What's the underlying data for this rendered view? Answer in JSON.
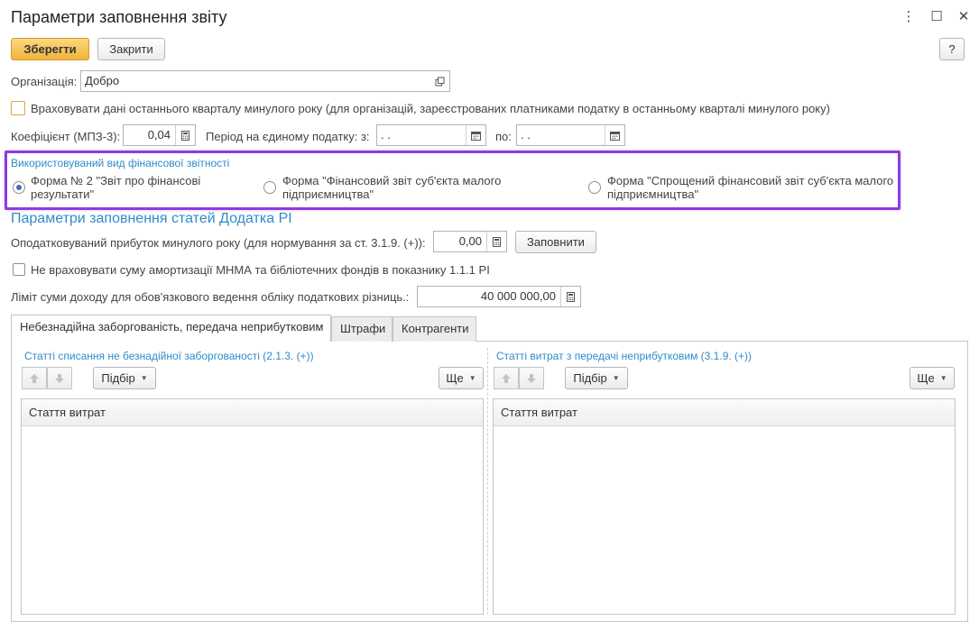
{
  "window": {
    "title": "Параметри заповнення звіту",
    "more_icon": "⋮",
    "maximize_icon": "☐",
    "close_icon": "✕"
  },
  "toolbar": {
    "save_label": "Зберегти",
    "close_label": "Закрити",
    "help_label": "?"
  },
  "organization": {
    "label": "Організація:",
    "value": "Добро"
  },
  "last_quarter": {
    "label": "Враховувати дані останнього кварталу минулого року (для організацій, зареєстрованих платниками податку в останньому кварталі минулого року)",
    "checked": false
  },
  "coefficient": {
    "label": "Коефіцієнт (МПЗ-3):",
    "value": "0,04"
  },
  "period": {
    "label": "Період на єдиному податку:  з:",
    "from_value": " .  .",
    "to_label": "по:",
    "to_value": " .  ."
  },
  "report_form": {
    "title": "Використовуваний вид фінансової звітності",
    "options": [
      {
        "label": "Форма № 2 \"Звіт про фінансові результати\"",
        "selected": true
      },
      {
        "label": "Форма \"Фінансовий звіт суб'єкта малого підприємництва\"",
        "selected": false
      },
      {
        "label": "Форма \"Спрощений фінансовий звіт суб'єкта малого підприємництва\"",
        "selected": false
      }
    ]
  },
  "appendix": {
    "title": "Параметри заповнення статей Додатка РІ",
    "taxable_profit_label": "Оподатковуваний прибуток минулого року (для нормування за ст. 3.1.9. (+)):",
    "taxable_profit_value": "0,00",
    "fill_label": "Заповнити",
    "amortization_label": "Не враховувати суму амортизації МНМА та бібліотечних фондів в показнику  1.1.1 РІ",
    "amortization_checked": false,
    "income_limit_label": "Ліміт суми доходу для обов'язкового ведення обліку податкових різниць.:",
    "income_limit_value": "40 000 000,00"
  },
  "tabs": [
    {
      "label": "Небезнадійна заборгованість, передача неприбутковим",
      "active": true
    },
    {
      "label": "Штрафи",
      "active": false
    },
    {
      "label": "Контрагенти",
      "active": false
    }
  ],
  "left_panel": {
    "title": "Статті списання не безнадійної заборгованості (2.1.3. (+))",
    "pick_label": "Підбір",
    "more_label": "Ще",
    "column_header": "Стаття витрат"
  },
  "right_panel": {
    "title": "Статті витрат з передачі неприбутковим (3.1.9. (+))",
    "pick_label": "Підбір",
    "more_label": "Ще",
    "column_header": "Стаття витрат"
  },
  "colors": {
    "accent_primary": "#f1b33e",
    "section_blue": "#2f8bc9",
    "highlight_purple": "#8e3be0"
  }
}
